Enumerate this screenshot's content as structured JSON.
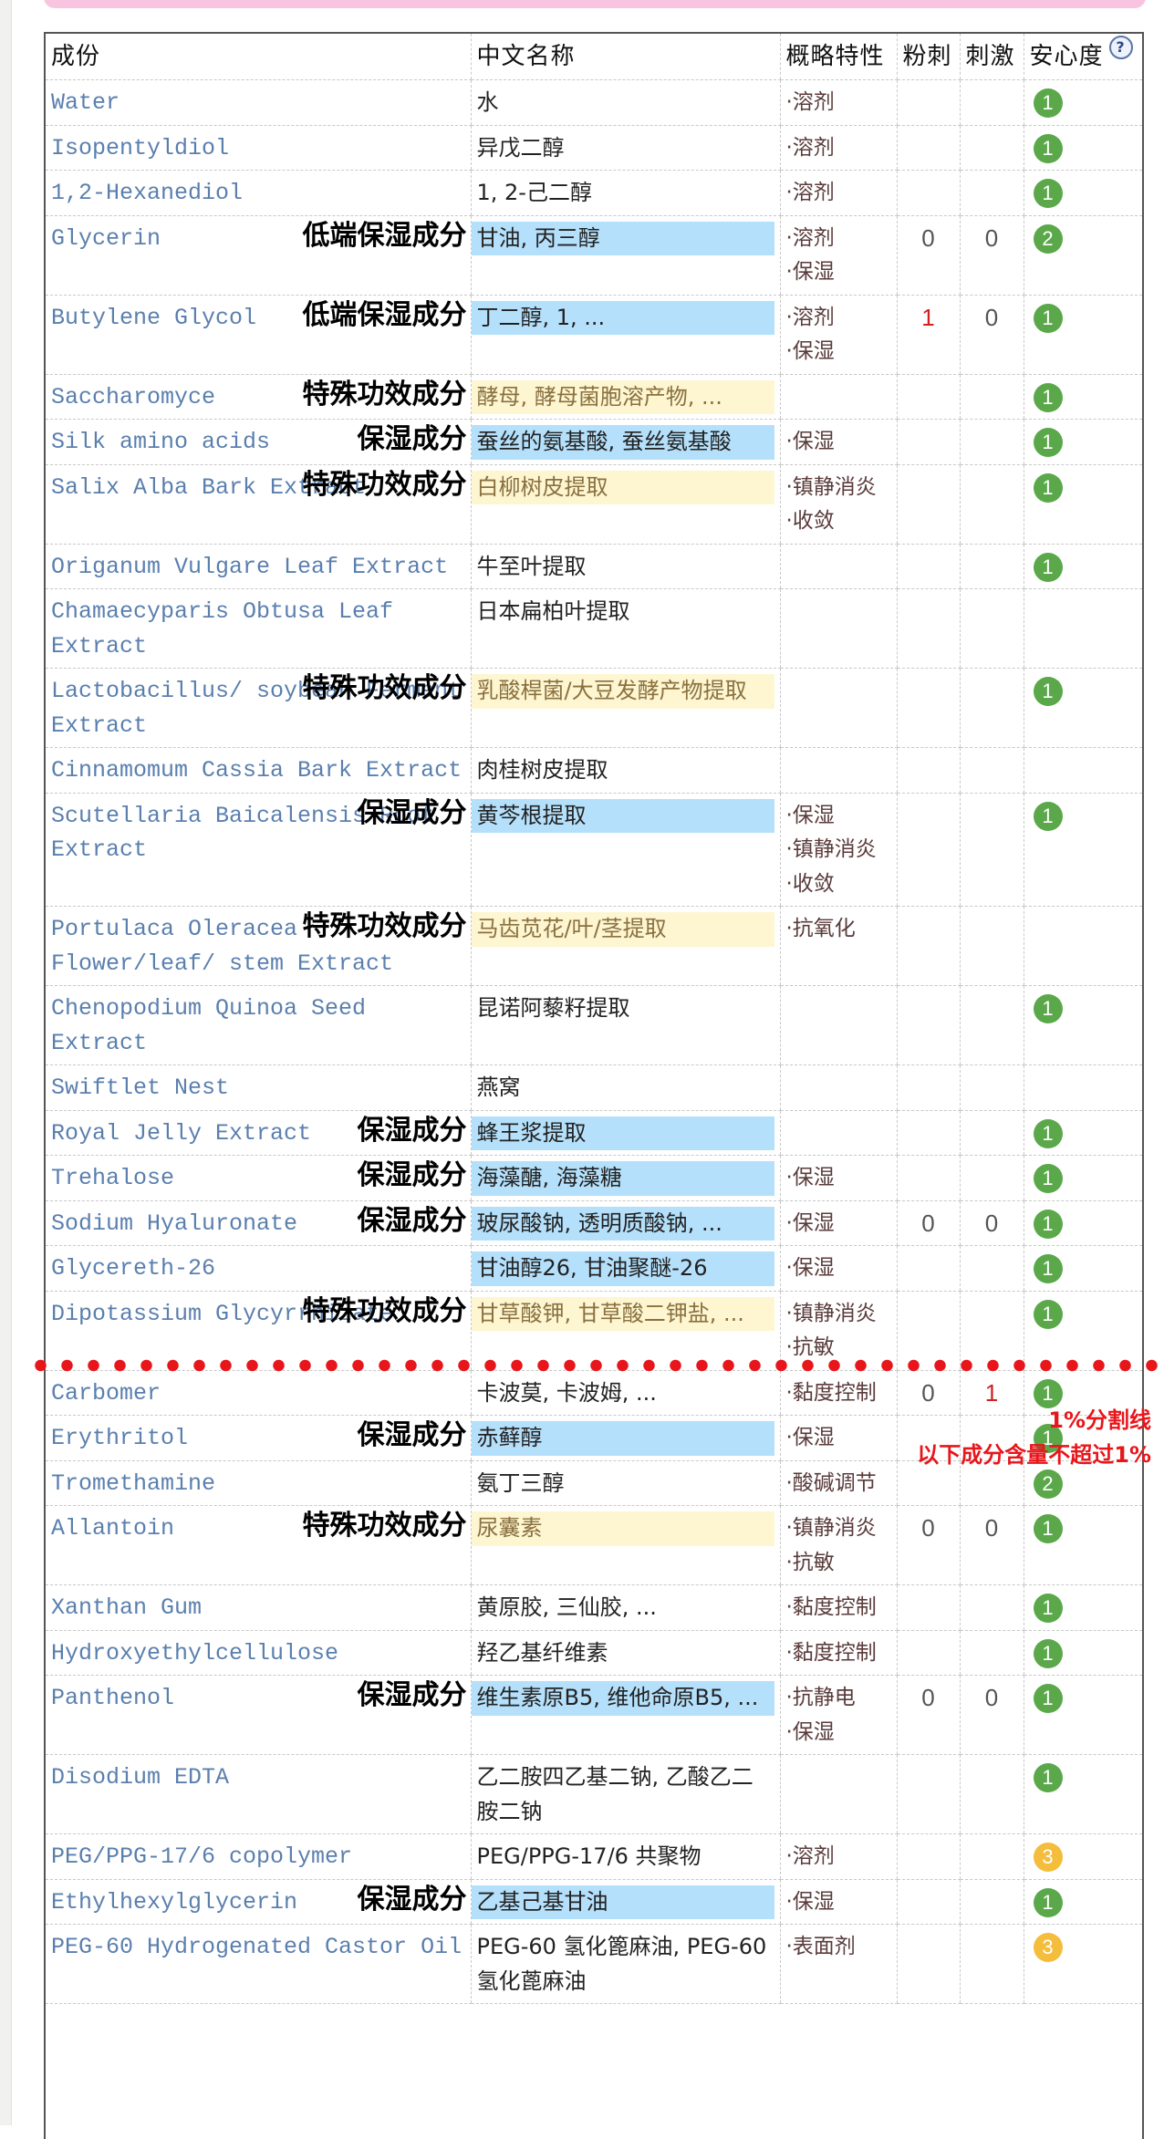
{
  "header": {
    "col_ingredient": "成份",
    "col_chinese": "中文名称",
    "col_property": "概略特性",
    "col_acne": "粉刺",
    "col_irritation": "刺激",
    "col_safety": "安心度",
    "help_icon": "?"
  },
  "colors": {
    "humectant_highlight": "#b5e0fb",
    "special_highlight": "#fdf6d1",
    "safety_green": "#5aa84a",
    "safety_yellow": "#f4bd3b",
    "divider_red": "#e8161b"
  },
  "annotations": {
    "divider_label": "1%分割线",
    "divider_note": "以下成分含量不超过1%"
  },
  "rows": [
    {
      "inci": "Water",
      "cn": "水",
      "hl": "",
      "tag": "",
      "props": [
        "·溶剂"
      ],
      "acne": "",
      "irr": "",
      "safety": "1",
      "level": "g"
    },
    {
      "inci": "Isopentyldiol",
      "cn": "异戊二醇",
      "hl": "",
      "tag": "",
      "props": [
        "·溶剂"
      ],
      "acne": "",
      "irr": "",
      "safety": "1",
      "level": "g"
    },
    {
      "inci": "1,2-Hexanediol",
      "cn": "1, 2-己二醇",
      "hl": "",
      "tag": "",
      "props": [
        "·溶剂"
      ],
      "acne": "",
      "irr": "",
      "safety": "1",
      "level": "g"
    },
    {
      "inci": "Glycerin",
      "cn": "甘油, 丙三醇",
      "hl": "blue",
      "tag": "低端保湿成分",
      "props": [
        "·溶剂",
        "·保湿"
      ],
      "acne": "0",
      "irr": "0",
      "safety": "2",
      "level": "g"
    },
    {
      "inci": "Butylene Glycol",
      "cn": "丁二醇, 1, ...",
      "hl": "blue",
      "tag": "低端保湿成分",
      "props": [
        "·溶剂",
        "·保湿"
      ],
      "acne": "1",
      "irr": "0",
      "safety": "1",
      "level": "g"
    },
    {
      "inci": "Saccharomyce",
      "cn": "酵母, 酵母菌胞溶产物, ...",
      "hl": "yellow",
      "tag": "特殊功效成分",
      "props": [],
      "acne": "",
      "irr": "",
      "safety": "1",
      "level": "g"
    },
    {
      "inci": "Silk amino acids",
      "cn": "蚕丝的氨基酸, 蚕丝氨基酸",
      "hl": "blue",
      "tag": "保湿成分",
      "props": [
        "·保湿"
      ],
      "acne": "",
      "irr": "",
      "safety": "1",
      "level": "g"
    },
    {
      "inci": "Salix Alba Bark Extract",
      "cn": "白柳树皮提取",
      "hl": "yellow",
      "tag": "特殊功效成分",
      "props": [
        "·镇静消炎",
        "·收敛"
      ],
      "acne": "",
      "irr": "",
      "safety": "1",
      "level": "g"
    },
    {
      "inci": "Origanum Vulgare Leaf Extract",
      "cn": "牛至叶提取",
      "hl": "",
      "tag": "",
      "props": [],
      "acne": "",
      "irr": "",
      "safety": "1",
      "level": "g"
    },
    {
      "inci": "Chamaecyparis Obtusa Leaf Extract",
      "cn": "日本扁柏叶提取",
      "hl": "",
      "tag": "",
      "props": [],
      "acne": "",
      "irr": "",
      "safety": "",
      "level": ""
    },
    {
      "inci": "Lactobacillus/ soybean Ferment Extract",
      "cn": "乳酸桿菌/大豆发酵产物提取",
      "hl": "yellow",
      "tag": "特殊功效成分",
      "props": [],
      "acne": "",
      "irr": "",
      "safety": "1",
      "level": "g"
    },
    {
      "inci": "Cinnamomum Cassia Bark Extract",
      "cn": "肉桂树皮提取",
      "hl": "",
      "tag": "",
      "props": [],
      "acne": "",
      "irr": "",
      "safety": "",
      "level": ""
    },
    {
      "inci": "Scutellaria Baicalensis Root Extract",
      "cn": "黄芩根提取",
      "hl": "blue",
      "tag": "保湿成分",
      "props": [
        "·保湿",
        "·镇静消炎",
        "·收敛"
      ],
      "acne": "",
      "irr": "",
      "safety": "1",
      "level": "g"
    },
    {
      "inci": "Portulaca Oleracea Flower/leaf/ stem Extract",
      "cn": "马齿苋花/叶/茎提取",
      "hl": "yellow",
      "tag": "特殊功效成分",
      "props": [
        "·抗氧化"
      ],
      "acne": "",
      "irr": "",
      "safety": "",
      "level": ""
    },
    {
      "inci": "Chenopodium Quinoa Seed Extract",
      "cn": "昆诺阿藜籽提取",
      "hl": "",
      "tag": "",
      "props": [],
      "acne": "",
      "irr": "",
      "safety": "1",
      "level": "g"
    },
    {
      "inci": "Swiftlet Nest",
      "cn": "燕窝",
      "hl": "",
      "tag": "",
      "props": [],
      "acne": "",
      "irr": "",
      "safety": "",
      "level": ""
    },
    {
      "inci": "Royal Jelly Extract",
      "cn": "蜂王浆提取",
      "hl": "blue",
      "tag": "保湿成分",
      "props": [],
      "acne": "",
      "irr": "",
      "safety": "1",
      "level": "g"
    },
    {
      "inci": "Trehalose",
      "cn": "海藻醣, 海藻糖",
      "hl": "blue",
      "tag": "保湿成分",
      "props": [
        "·保湿"
      ],
      "acne": "",
      "irr": "",
      "safety": "1",
      "level": "g"
    },
    {
      "inci": "Sodium Hyaluronate",
      "cn": "玻尿酸钠, 透明质酸钠, ...",
      "hl": "blue",
      "tag": "保湿成分",
      "props": [
        "·保湿"
      ],
      "acne": "0",
      "irr": "0",
      "safety": "1",
      "level": "g"
    },
    {
      "inci": "Glycereth-26",
      "cn": "甘油醇26, 甘油聚醚-26",
      "hl": "blue",
      "tag": "",
      "props": [
        "·保湿"
      ],
      "acne": "",
      "irr": "",
      "safety": "1",
      "level": "g"
    },
    {
      "inci": "Dipotassium Glycyrrhizate",
      "cn": "甘草酸钾, 甘草酸二钾盐, ...",
      "hl": "yellow",
      "tag": "特殊功效成分",
      "props": [
        "·镇静消炎",
        "·抗敏"
      ],
      "acne": "",
      "irr": "",
      "safety": "1",
      "level": "g"
    },
    {
      "inci": "Carbomer",
      "cn": "卡波莫, 卡波姆, ...",
      "hl": "",
      "tag": "",
      "props": [
        "·黏度控制"
      ],
      "acne": "0",
      "irr": "1",
      "safety": "1",
      "level": "g"
    },
    {
      "inci": "Erythritol",
      "cn": "赤藓醇",
      "hl": "blue",
      "tag": "保湿成分",
      "props": [
        "·保湿"
      ],
      "acne": "",
      "irr": "",
      "safety": "1",
      "level": "g"
    },
    {
      "inci": "Tromethamine",
      "cn": "氨丁三醇",
      "hl": "",
      "tag": "",
      "props": [
        "·酸碱调节"
      ],
      "acne": "",
      "irr": "",
      "safety": "2",
      "level": "g"
    },
    {
      "inci": "Allantoin",
      "cn": "尿囊素",
      "hl": "yellow",
      "tag": "特殊功效成分",
      "props": [
        "·镇静消炎",
        "·抗敏"
      ],
      "acne": "0",
      "irr": "0",
      "safety": "1",
      "level": "g"
    },
    {
      "inci": "Xanthan Gum",
      "cn": "黄原胶, 三仙胶, ...",
      "hl": "",
      "tag": "",
      "props": [
        "·黏度控制"
      ],
      "acne": "",
      "irr": "",
      "safety": "1",
      "level": "g"
    },
    {
      "inci": "Hydroxyethylcellulose",
      "cn": "羟乙基纤维素",
      "hl": "",
      "tag": "",
      "props": [
        "·黏度控制"
      ],
      "acne": "",
      "irr": "",
      "safety": "1",
      "level": "g"
    },
    {
      "inci": "Panthenol",
      "cn": "维生素原B5, 维他命原B5, ...",
      "hl": "blue",
      "tag": "保湿成分",
      "props": [
        "·抗静电",
        "·保湿"
      ],
      "acne": "0",
      "irr": "0",
      "safety": "1",
      "level": "g"
    },
    {
      "inci": "Disodium EDTA",
      "cn": "乙二胺四乙基二钠, 乙酸乙二胺二钠",
      "hl": "",
      "tag": "",
      "props": [],
      "acne": "",
      "irr": "",
      "safety": "1",
      "level": "g"
    },
    {
      "inci": "PEG/PPG-17/6 copolymer",
      "cn": "PEG/PPG-17/6 共聚物",
      "hl": "",
      "tag": "",
      "props": [
        "·溶剂"
      ],
      "acne": "",
      "irr": "",
      "safety": "3",
      "level": "y"
    },
    {
      "inci": "Ethylhexylglycerin",
      "cn": "乙基己基甘油",
      "hl": "blue",
      "tag": "保湿成分",
      "props": [
        "·保湿"
      ],
      "acne": "",
      "irr": "",
      "safety": "1",
      "level": "g"
    },
    {
      "inci": "PEG-60 Hydrogenated Castor Oil",
      "cn": "PEG-60 氢化篦麻油, PEG-60氢化蓖麻油",
      "hl": "",
      "tag": "",
      "props": [
        "·表面剂"
      ],
      "acne": "",
      "irr": "",
      "safety": "3",
      "level": "y"
    }
  ]
}
